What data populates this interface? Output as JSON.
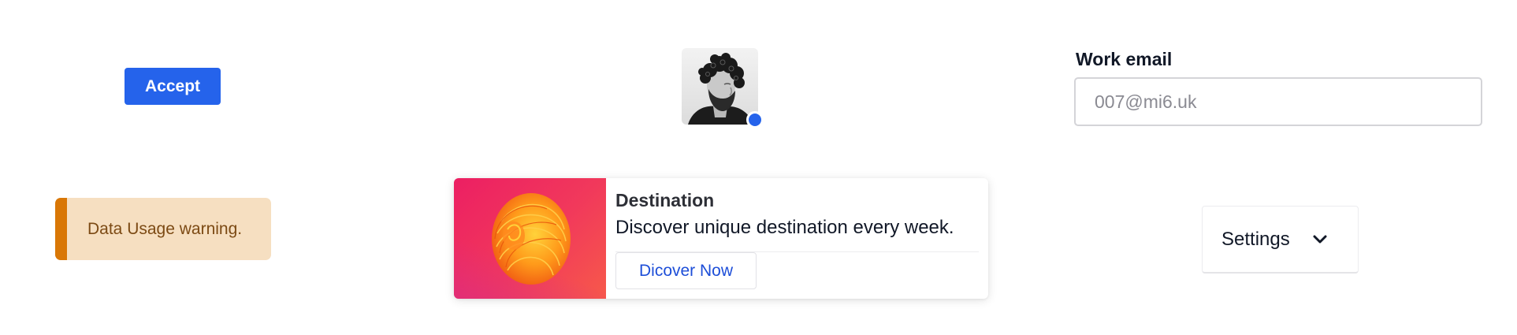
{
  "accept_button": {
    "label": "Accept",
    "color": "#2563eb"
  },
  "avatar": {
    "icon": "portrait-avatar",
    "status_icon": "online-status-dot",
    "status_color": "#2563eb"
  },
  "email_field": {
    "label": "Work email",
    "placeholder": "007@mi6.uk",
    "value": ""
  },
  "alert": {
    "text": "Data Usage warning.",
    "accent_color": "#d97706",
    "background_color": "#f6dfc1"
  },
  "card": {
    "image_icon": "abstract-swirl-image",
    "title": "Destination",
    "description": "Discover unique destination every week.",
    "button_label": "Dicover Now"
  },
  "settings_dropdown": {
    "label": "Settings",
    "icon": "chevron-down-icon"
  }
}
